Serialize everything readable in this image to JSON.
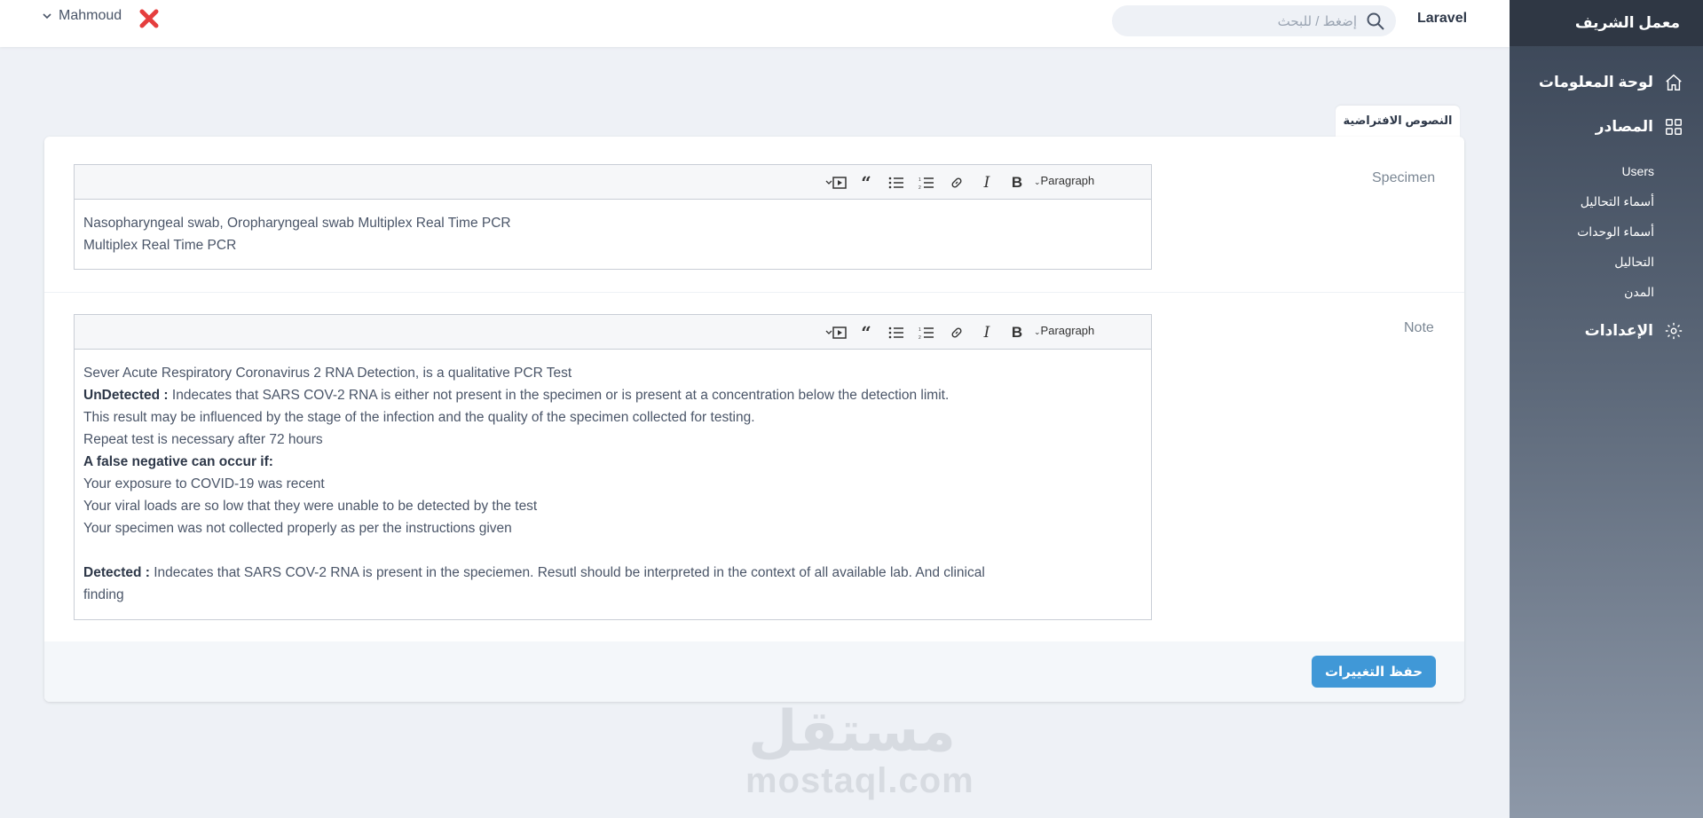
{
  "sidebar": {
    "title": "معمل الشريف",
    "dashboard": "لوحة المعلومات",
    "resources": "المصادر",
    "resource_items": [
      "Users",
      "أسماء التحاليل",
      "أسماء الوحدات",
      "التحاليل",
      "المدن"
    ],
    "settings": "الإعدادات"
  },
  "topbar": {
    "brand": "Laravel",
    "search_placeholder": "إضغط / للبحث",
    "user_name": "Mahmoud"
  },
  "tab": {
    "label": "النصوص الافتراضية"
  },
  "specimen": {
    "label": "Specimen",
    "toolbar_format": "Paragraph",
    "lines": [
      "Nasopharyngeal swab, Oropharyngeal swab Multiplex Real Time PCR",
      "Multiplex Real Time PCR"
    ]
  },
  "note": {
    "label": "Note",
    "toolbar_format": "Paragraph",
    "line1": "Sever Acute Respiratory Coronavirus 2 RNA Detection, is a qualitative PCR Test",
    "undetected_bold": "UnDetected :",
    "undetected_text": " Indecates that SARS COV-2 RNA is either not present in the specimen or is present at a concentration below the detection limit.",
    "line3": "This result may be influenced by the stage of the infection and the quality of the specimen collected for testing.",
    "line4": "Repeat test is necessary after 72 hours",
    "false_negative_heading": "A false negative can occur if:",
    "line6": "Your exposure to COVID-19 was recent",
    "line7": "Your viral loads are so low that they were unable to be detected by the test",
    "line8": "Your specimen was not collected properly as per the instructions given",
    "detected_bold": "Detected :",
    "detected_text": " Indecates that SARS COV-2 RNA is present in the speciemen. Resutl should be interpreted in the context of all available lab. And clinical",
    "detected_text2": "finding"
  },
  "footer": {
    "save_label": "حفظ التغييرات"
  },
  "watermark": {
    "arabic": "مستقل",
    "latin": "mostaql.com"
  },
  "colors": {
    "accent": "#4098d7",
    "sidebar_dark": "#2f3744",
    "user_x": "#e53e3e"
  }
}
